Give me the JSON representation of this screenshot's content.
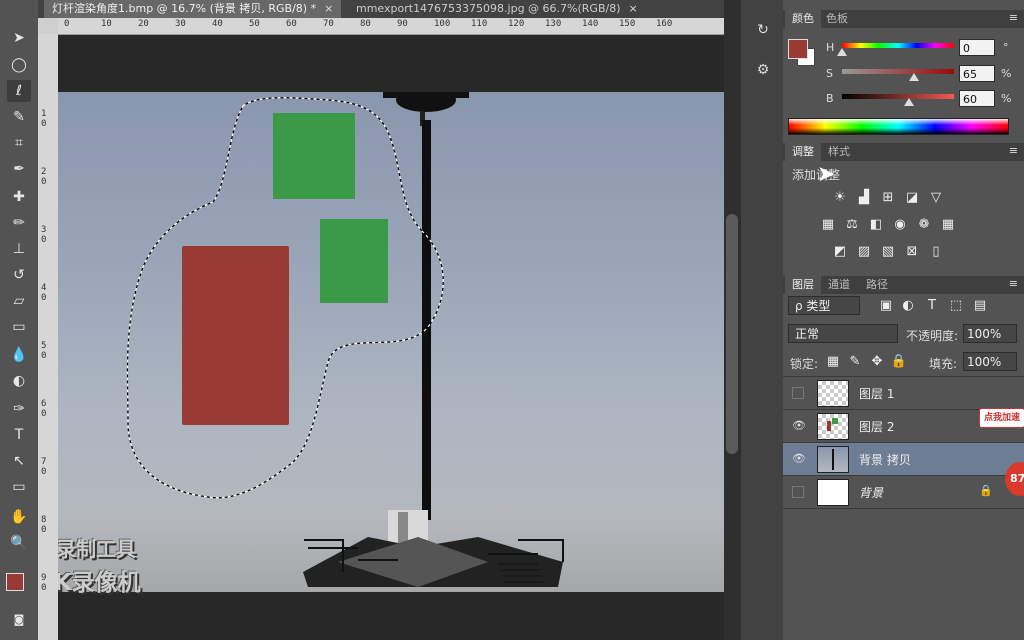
{
  "tabs": [
    {
      "label": "灯杆渲染角度1.bmp @ 16.7% (背景 拷贝, RGB/8) *",
      "close": "×",
      "active": true
    },
    {
      "label": "mmexport1476753375098.jpg @ 66.7%(RGB/8)",
      "close": "×",
      "active": false
    }
  ],
  "ruler_top_labels": [
    "0",
    "10",
    "20",
    "30",
    "40",
    "50",
    "60",
    "70",
    "80",
    "90",
    "100",
    "110",
    "120",
    "130",
    "140",
    "150",
    "160"
  ],
  "ruler_left_labels": [
    "1\n0",
    "2\n0",
    "3\n0",
    "4\n0",
    "5\n0",
    "6\n0",
    "7\n0",
    "8\n0",
    "9\n0"
  ],
  "colors": {
    "foreground": "#9a3a34",
    "background": "#ffffff",
    "red_block": "#9a3a34",
    "green_block": "#3a9a47",
    "selected_layer": "#6d7d93"
  },
  "color_panel": {
    "tabs": [
      "颜色",
      "色板"
    ],
    "menu": "≡",
    "sliders": [
      {
        "label": "H",
        "value": "0",
        "unit": "°",
        "level": 0.0
      },
      {
        "label": "S",
        "value": "65",
        "unit": "%",
        "level": 0.65
      },
      {
        "label": "B",
        "value": "60",
        "unit": "%",
        "level": 0.6
      }
    ]
  },
  "adjust_panel": {
    "tabs": [
      "调整",
      "样式"
    ],
    "menu": "≡",
    "title": "添加调整",
    "icons_row1": [
      "brightness-icon",
      "levels-icon",
      "curves-icon",
      "exposure-icon",
      "vibrance-icon"
    ],
    "icons_row2": [
      "hue-saturation-icon",
      "color-balance-icon",
      "black-white-icon",
      "photo-filter-icon",
      "channel-mixer-icon",
      "color-lookup-icon"
    ],
    "icons_row3": [
      "invert-icon",
      "posterize-icon",
      "threshold-icon",
      "selective-color-icon",
      "gradient-map-icon"
    ]
  },
  "layers_panel": {
    "tabs": [
      "图层",
      "通道",
      "路径"
    ],
    "menu": "≡",
    "filter_label": "ρ 类型",
    "blend_mode": "正常",
    "opacity_label": "不透明度:",
    "opacity_value": "100%",
    "lock_label": "锁定:",
    "fill_label": "填充:",
    "fill_value": "100%",
    "layers": [
      {
        "name": "图层 1",
        "visible": false,
        "selected": false,
        "thumb": "checker"
      },
      {
        "name": "图层 2",
        "visible": true,
        "selected": false,
        "thumb": "checker-red-green"
      },
      {
        "name": "背景 拷贝",
        "visible": true,
        "selected": true,
        "thumb": "photo"
      },
      {
        "name": "背景",
        "visible": false,
        "selected": false,
        "thumb": "white",
        "locked": true
      }
    ]
  },
  "overlays": {
    "speed_badge": "点我加速",
    "counter": "87"
  },
  "watermark": {
    "line1": "录制工具",
    "line2": "KK录像机"
  }
}
